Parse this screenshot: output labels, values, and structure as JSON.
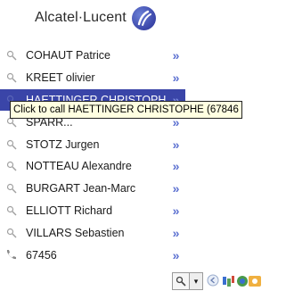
{
  "brand": {
    "name": "Alcatel·Lucent"
  },
  "contacts": [
    {
      "name": "COHAUT Patrice",
      "icon": "search-icon"
    },
    {
      "name": "KREET olivier",
      "icon": "search-icon"
    },
    {
      "name": "HAETTINGER CHRISTOPHE",
      "icon": "search-icon",
      "selected": true
    },
    {
      "name": "SPARR...",
      "icon": "search-icon"
    },
    {
      "name": "STOTZ Jurgen",
      "icon": "search-icon"
    },
    {
      "name": "NOTTEAU Alexandre",
      "icon": "search-icon"
    },
    {
      "name": "BURGART Jean-Marc",
      "icon": "search-icon"
    },
    {
      "name": "ELLIOTT Richard",
      "icon": "search-icon"
    },
    {
      "name": "VILLARS Sebastien",
      "icon": "search-icon"
    },
    {
      "name": "67456",
      "icon": "phone-icon"
    }
  ],
  "arrow_glyph": "»",
  "tooltip": {
    "text": "Click to call HAETTINGER CHRISTOPHE (67846"
  },
  "taskbar": {
    "dropdown_glyph": "▾"
  },
  "colors": {
    "selected_bg": "#3a45a8",
    "arrow": "#5a6fd0",
    "tooltip_bg": "#ffffe1"
  }
}
